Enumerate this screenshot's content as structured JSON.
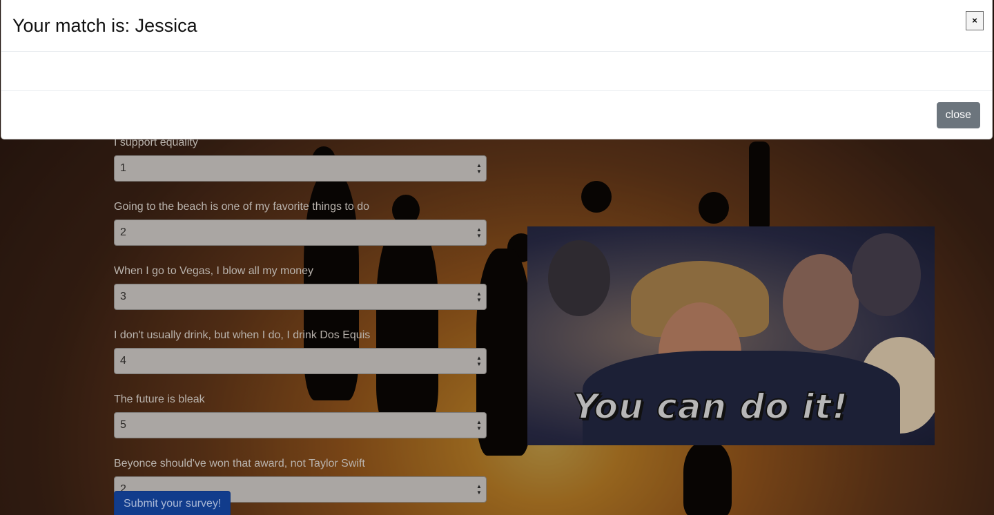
{
  "modal": {
    "title": "Your match is: Jessica",
    "close_icon": "×",
    "close_button_label": "close"
  },
  "survey": {
    "questions": [
      {
        "label": "I support equality",
        "value": "1"
      },
      {
        "label": "Going to the beach is one of my favorite things to do",
        "value": "2"
      },
      {
        "label": "When I go to Vegas, I blow all my money",
        "value": "3"
      },
      {
        "label": "I don't usually drink, but when I do, I drink Dos Equis",
        "value": "4"
      },
      {
        "label": "The future is bleak",
        "value": "5"
      },
      {
        "label": "Beyonce should've won that award, not Taylor Swift",
        "value": "2"
      }
    ],
    "submit_label": "Submit your survey!"
  },
  "gif": {
    "caption": "You can do it!"
  },
  "colors": {
    "primary_button": "#113c8c",
    "secondary_button": "#6c757d"
  }
}
